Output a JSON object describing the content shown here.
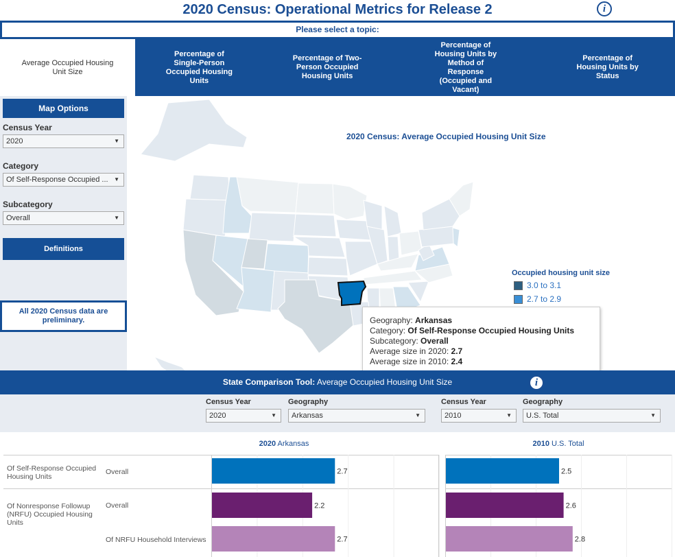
{
  "header": {
    "title": "2020 Census: Operational Metrics for Release 2",
    "info_icon": "i",
    "topic_prompt": "Please select a topic:"
  },
  "tabs": [
    {
      "label": "Average Occupied Housing Unit Size",
      "active": true
    },
    {
      "label": "Percentage of Single-Person Occupied Housing Units",
      "active": false
    },
    {
      "label": "Percentage of Two-Person Occupied Housing Units",
      "active": false
    },
    {
      "label": "Percentage of Housing Units by Method of Response (Occupied and Vacant)",
      "active": false
    },
    {
      "label": "Percentage of Housing Units by Status",
      "active": false
    }
  ],
  "sidebar": {
    "map_options_label": "Map Options",
    "census_year_label": "Census Year",
    "census_year_value": "2020",
    "category_label": "Category",
    "category_value": "Of Self-Response Occupied ...",
    "subcategory_label": "Subcategory",
    "subcategory_value": "Overall",
    "definitions_label": "Definitions",
    "preliminary_note": "All 2020 Census data are preliminary."
  },
  "map": {
    "title": "2020 Census: Average Occupied Housing Unit Size",
    "highlighted_state": "Arkansas",
    "legend": {
      "title": "Occupied housing unit size",
      "items": [
        {
          "label": "3.0 to 3.1",
          "color": "#2e5f80"
        },
        {
          "label": "2.7 to 2.9",
          "color": "#3a8fd6"
        }
      ]
    },
    "colors": {
      "highlight": "#0072bc",
      "light": "#e2e9f0",
      "lighter": "#eef2f4",
      "mid": "#d3e3ee",
      "grey": "#d2dbe1"
    }
  },
  "tooltip": {
    "geography_label": "Geography: ",
    "geography_value": "Arkansas",
    "category_label": "Category: ",
    "category_value": "Of Self-Response Occupied Housing Units",
    "subcategory_label": "Subcategory: ",
    "subcategory_value": "Overall",
    "avg2020_label": "Average size in 2020: ",
    "avg2020_value": "2.7",
    "avg2010_label": "Average size in 2010: ",
    "avg2010_value": "2.4"
  },
  "comparison": {
    "header_bold": "State Comparison Tool:",
    "header_rest": " Average Occupied Housing Unit Size",
    "left": {
      "year_label": "Census Year",
      "year_value": "2020",
      "geo_label": "Geography",
      "geo_value": "Arkansas"
    },
    "right": {
      "year_label": "Census Year",
      "year_value": "2010",
      "geo_label": "Geography",
      "geo_value": "U.S. Total"
    },
    "rows": [
      {
        "category": "Of Self-Response Occupied Housing Units",
        "subcategory": "Overall"
      },
      {
        "category": "Of Nonresponse Followup (NRFU) Occupied Housing Units",
        "subcategory": "Overall"
      },
      {
        "category": "",
        "subcategory": "Of NRFU Household Interviews"
      }
    ]
  },
  "chart_data": [
    {
      "type": "bar",
      "orientation": "horizontal",
      "title_bold": "2020",
      "title_rest": " Arkansas",
      "categories": [
        "Self-Response Overall",
        "NRFU Overall",
        "Of NRFU Household Interviews"
      ],
      "values": [
        2.7,
        2.2,
        2.7
      ],
      "labels": [
        "2.7",
        "2.2",
        "2.7"
      ],
      "colors": [
        "#0072bc",
        "#6a1f6f",
        "#b484b8"
      ],
      "xlim": [
        0,
        5
      ],
      "grid": true
    },
    {
      "type": "bar",
      "orientation": "horizontal",
      "title_bold": "2010",
      "title_rest": " U.S. Total",
      "categories": [
        "Self-Response Overall",
        "NRFU Overall",
        "Of NRFU Household Interviews"
      ],
      "values": [
        2.5,
        2.6,
        2.8
      ],
      "labels": [
        "2.5",
        "2.6",
        "2.8"
      ],
      "colors": [
        "#0072bc",
        "#6a1f6f",
        "#b484b8"
      ],
      "xlim": [
        0,
        5
      ],
      "grid": true
    }
  ]
}
